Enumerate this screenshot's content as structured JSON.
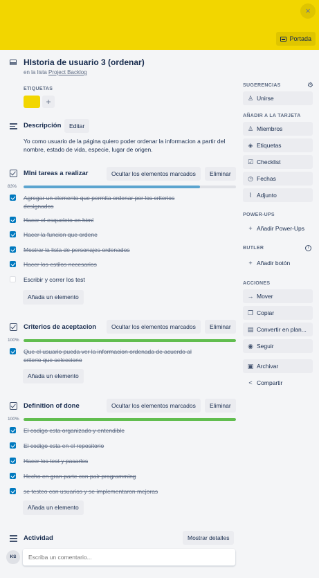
{
  "cover": {
    "button_label": "Portada",
    "color": "#f2d600",
    "close_icon": "×"
  },
  "card": {
    "title": "HIstoria de usuario 3 (ordenar)",
    "in_list_prefix": "en la lista",
    "list_name": "Project Backlog"
  },
  "labels": {
    "title": "ETIQUETAS",
    "add": "+",
    "chip_color": "#f2d600"
  },
  "description": {
    "title": "Descripción",
    "edit": "Editar",
    "text": "Yo como usuario de la página quiero poder ordenar la informacion a partir del nombre, estado de vida, especie, lugar de origen."
  },
  "checklists": [
    {
      "title": "MIni tareas a realizar",
      "hide_label": "Ocultar los elementos marcados",
      "delete_label": "Eliminar",
      "percent_label": "83%",
      "progress": 0.83,
      "add_label": "Añada un elemento",
      "items": [
        {
          "text": "Agregar un elemento que permita ordenar por los criterios designados",
          "done": true
        },
        {
          "text": "Hacer el esqueleto en html",
          "done": true
        },
        {
          "text": "Hacer la funcion que ordene",
          "done": true
        },
        {
          "text": "Mostrar la lista de personajes ordenados",
          "done": true
        },
        {
          "text": "Hacer los estilos necesarios",
          "done": true
        },
        {
          "text": "Escribir y correr los test",
          "done": false
        }
      ]
    },
    {
      "title": "Criterios de aceptacion",
      "hide_label": "Ocultar los elementos marcados",
      "delete_label": "Eliminar",
      "percent_label": "100%",
      "progress": 1.0,
      "add_label": "Añada un elemento",
      "items": [
        {
          "text": "Que el usuario pueda ver la informacion ordenada de acuerdo al criterio que selecciono",
          "done": true
        }
      ]
    },
    {
      "title": "Definition of done",
      "hide_label": "Ocultar los elementos marcados",
      "delete_label": "Eliminar",
      "percent_label": "100%",
      "progress": 1.0,
      "add_label": "Añada un elemento",
      "items": [
        {
          "text": "El codigo esta organizado y entendible",
          "done": true
        },
        {
          "text": "El codigo esta en el repositorio",
          "done": true
        },
        {
          "text": "Hacer los test y pasarlos",
          "done": true
        },
        {
          "text": "Hecho en gran parte con pair programming",
          "done": true
        },
        {
          "text": "se testeo con usuarios y se implementaron mejoras",
          "done": true
        }
      ]
    }
  ],
  "activity": {
    "title": "Actividad",
    "details_label": "Mostrar detalles",
    "avatar_initials": "KS",
    "comment_placeholder": "Escriba un comentario..."
  },
  "sidebar": {
    "suggestions_title": "SUGERENCIAS",
    "join": "Unirse",
    "add_title": "AÑADIR A LA TARJETA",
    "members": "Miembros",
    "labels": "Etiquetas",
    "checklist": "Checklist",
    "dates": "Fechas",
    "attachment": "Adjunto",
    "powerups_title": "POWER-UPS",
    "add_powerups": "Añadir Power-Ups",
    "butler_title": "BUTLER",
    "add_button": "Añadir botón",
    "actions_title": "ACCIONES",
    "move": "Mover",
    "copy": "Copiar",
    "convert": "Convertir en plan...",
    "follow": "Seguir",
    "archive": "Archivar",
    "share": "Compartir"
  }
}
